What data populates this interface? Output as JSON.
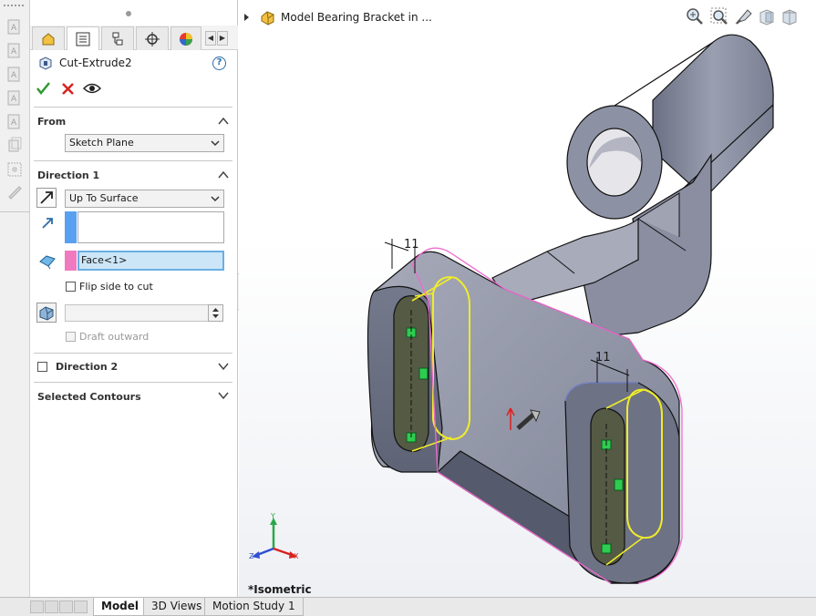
{
  "document_title": "Model Bearing Bracket in ...",
  "property_manager": {
    "feature_name": "Cut-Extrude2",
    "help_glyph": "?",
    "tabs": [
      "feature-manager",
      "property-manager",
      "configuration-manager",
      "dim-xpert-manager",
      "display-manager"
    ],
    "from_section": {
      "heading": "From",
      "start_condition": "Sketch Plane"
    },
    "direction1_section": {
      "heading": "Direction 1",
      "end_condition": "Up To Surface",
      "direction_value": "",
      "face_value": "Face<1>",
      "flip_label": "Flip side to cut",
      "draft_value": "",
      "draft_outward_label": "Draft outward"
    },
    "direction2_section": {
      "heading": "Direction 2"
    },
    "selected_contours_section": {
      "heading": "Selected Contours"
    }
  },
  "viewport": {
    "view_orientation": "*Isometric",
    "dimension_labels": [
      "11",
      "11"
    ],
    "triad_labels": {
      "y": "Y",
      "x": "X",
      "z": "Z"
    }
  },
  "bottom_tabs": [
    "Model",
    "3D Views",
    "Motion Study 1"
  ],
  "colors": {
    "accent_blue": "#2b6ca8",
    "direction_tag": "#5aa0f0",
    "face_tag": "#f07ac0",
    "face_field_bg": "#cde6f7",
    "preview_yellow": "#f0ec2a",
    "selection_pink": "#f06ad0",
    "model_grey": "#7c8193"
  }
}
